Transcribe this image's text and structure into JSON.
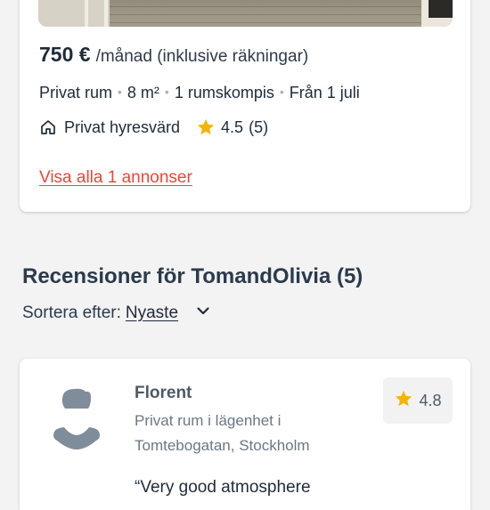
{
  "listing": {
    "price": "750 €",
    "price_suffix": "/månad (inklusive räkningar)",
    "room_type": "Privat rum",
    "size": "8 m²",
    "roommates": "1 rumskompis",
    "available_from": "Från 1 juli",
    "landlord_type": "Privat hyresvärd",
    "rating": "4.5",
    "review_count": "(5)",
    "all_listings_link": "Visa alla 1 annonser"
  },
  "reviews": {
    "title": "Recensioner för TomandOlivia (5)",
    "sort_label": "Sortera efter:",
    "sort_value": "Nyaste",
    "items": [
      {
        "name": "Florent",
        "detail": "Privat rum i lägenhet i Tomtebogatan, Stockholm",
        "rating": "4.8",
        "quote": "“Very good atmosphere"
      }
    ]
  },
  "colors": {
    "link": "#e8473a",
    "star": "#f2b500",
    "text": "#1f2b3a"
  },
  "icons": {
    "landlord": "house-icon",
    "rating": "star-icon",
    "sort": "chevron-down-icon",
    "avatar": "user-avatar-icon"
  }
}
